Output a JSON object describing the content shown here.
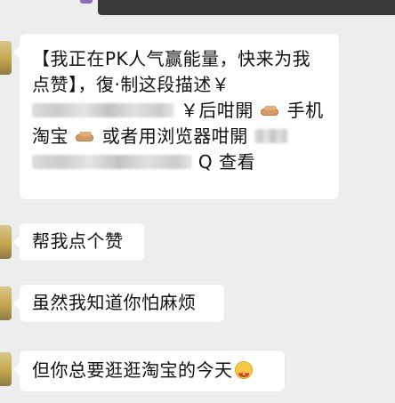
{
  "messages": [
    {
      "type": "incoming",
      "lines": [
        "【我正在PK人气赢能量，快来为我",
        "点赞】，復·制这段描述￥",
        "￥后咁開",
        "手机",
        "淘宝",
        "或者用浏览器咁開",
        "Q 查看"
      ]
    },
    {
      "type": "incoming",
      "text": "帮我点个赞"
    },
    {
      "type": "incoming",
      "text": "虽然我知道你怕麻烦"
    },
    {
      "type": "incoming",
      "text": "但你总要逛逛淘宝的今天"
    }
  ]
}
